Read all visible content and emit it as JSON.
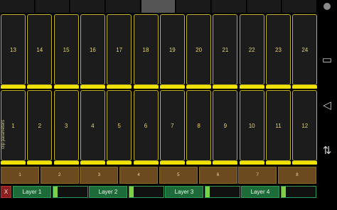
{
  "top_tabs": {
    "count": 9,
    "active_index": 4
  },
  "clip_row_top": [
    "13",
    "14",
    "15",
    "16",
    "17",
    "18",
    "19",
    "20",
    "21",
    "22",
    "23",
    "24"
  ],
  "clip_row_bottom": [
    "1",
    "2",
    "3",
    "4",
    "5",
    "6",
    "7",
    "8",
    "9",
    "10",
    "11",
    "12"
  ],
  "side_label": "clip parameters",
  "banks": [
    "1",
    "2",
    "3",
    "4",
    "5",
    "6",
    "7",
    "8"
  ],
  "close_label": "X",
  "layers": [
    {
      "label": "Layer 1",
      "level": 0.12
    },
    {
      "label": "Layer 2",
      "level": 0.12
    },
    {
      "label": "Layer 3",
      "level": 0.12
    },
    {
      "label": "Layer 4",
      "level": 0.12
    }
  ],
  "colors": {
    "cell_border": "#bfb31f",
    "cell_bar": "#f1e100",
    "bank_bg": "#6b4a1f",
    "layer_bg": "#1e6b3a",
    "close_bg": "#8d1f1f"
  },
  "system_nav": {
    "icons": [
      "recent-apps-icon",
      "back-icon",
      "rotate-icon"
    ],
    "glyphs": [
      "▭",
      "◁",
      "⇅"
    ]
  }
}
